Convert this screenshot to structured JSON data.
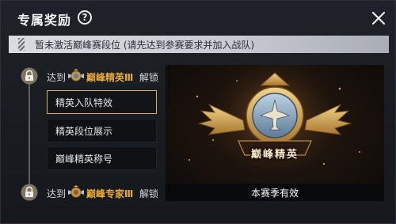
{
  "header": {
    "title": "专属奖励",
    "help_glyph": "?",
    "close_icon": "close-icon"
  },
  "banner": {
    "text": "暂未激活巅峰赛段位 (请先达到参赛要求并加入战队)"
  },
  "tiers": [
    {
      "reach_label": "达到",
      "rank_name": "巅峰精英Ⅲ",
      "unlock_label": "解锁",
      "locked": true,
      "rewards": [
        {
          "label": "精英入队特效",
          "selected": true
        },
        {
          "label": "精英段位展示",
          "selected": false
        },
        {
          "label": "巅峰精英称号",
          "selected": false
        }
      ]
    },
    {
      "reach_label": "达到",
      "rank_name": "巅峰专家Ⅲ",
      "unlock_label": "解锁",
      "locked": true
    }
  ],
  "preview": {
    "badge_text": "巅峰精英",
    "caption": "本赛季有效"
  },
  "colors": {
    "accent_gold": "#e8a93a",
    "selected_border": "#d8b15d"
  }
}
